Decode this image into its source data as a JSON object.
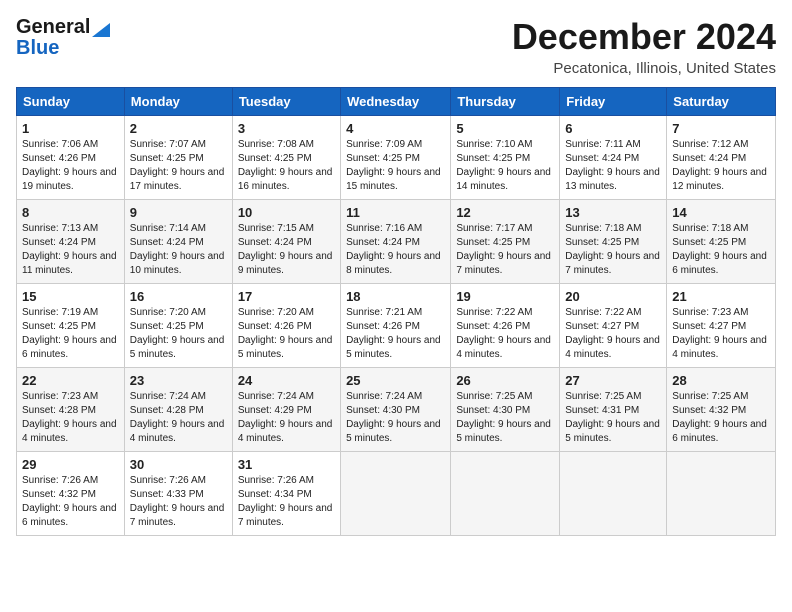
{
  "logo": {
    "line1": "General",
    "line2": "Blue"
  },
  "header": {
    "month": "December 2024",
    "location": "Pecatonica, Illinois, United States"
  },
  "weekdays": [
    "Sunday",
    "Monday",
    "Tuesday",
    "Wednesday",
    "Thursday",
    "Friday",
    "Saturday"
  ],
  "weeks": [
    [
      {
        "day": "1",
        "sunrise": "7:06 AM",
        "sunset": "4:26 PM",
        "daylight": "9 hours and 19 minutes."
      },
      {
        "day": "2",
        "sunrise": "7:07 AM",
        "sunset": "4:25 PM",
        "daylight": "9 hours and 17 minutes."
      },
      {
        "day": "3",
        "sunrise": "7:08 AM",
        "sunset": "4:25 PM",
        "daylight": "9 hours and 16 minutes."
      },
      {
        "day": "4",
        "sunrise": "7:09 AM",
        "sunset": "4:25 PM",
        "daylight": "9 hours and 15 minutes."
      },
      {
        "day": "5",
        "sunrise": "7:10 AM",
        "sunset": "4:25 PM",
        "daylight": "9 hours and 14 minutes."
      },
      {
        "day": "6",
        "sunrise": "7:11 AM",
        "sunset": "4:24 PM",
        "daylight": "9 hours and 13 minutes."
      },
      {
        "day": "7",
        "sunrise": "7:12 AM",
        "sunset": "4:24 PM",
        "daylight": "9 hours and 12 minutes."
      }
    ],
    [
      {
        "day": "8",
        "sunrise": "7:13 AM",
        "sunset": "4:24 PM",
        "daylight": "9 hours and 11 minutes."
      },
      {
        "day": "9",
        "sunrise": "7:14 AM",
        "sunset": "4:24 PM",
        "daylight": "9 hours and 10 minutes."
      },
      {
        "day": "10",
        "sunrise": "7:15 AM",
        "sunset": "4:24 PM",
        "daylight": "9 hours and 9 minutes."
      },
      {
        "day": "11",
        "sunrise": "7:16 AM",
        "sunset": "4:24 PM",
        "daylight": "9 hours and 8 minutes."
      },
      {
        "day": "12",
        "sunrise": "7:17 AM",
        "sunset": "4:25 PM",
        "daylight": "9 hours and 7 minutes."
      },
      {
        "day": "13",
        "sunrise": "7:18 AM",
        "sunset": "4:25 PM",
        "daylight": "9 hours and 7 minutes."
      },
      {
        "day": "14",
        "sunrise": "7:18 AM",
        "sunset": "4:25 PM",
        "daylight": "9 hours and 6 minutes."
      }
    ],
    [
      {
        "day": "15",
        "sunrise": "7:19 AM",
        "sunset": "4:25 PM",
        "daylight": "9 hours and 6 minutes."
      },
      {
        "day": "16",
        "sunrise": "7:20 AM",
        "sunset": "4:25 PM",
        "daylight": "9 hours and 5 minutes."
      },
      {
        "day": "17",
        "sunrise": "7:20 AM",
        "sunset": "4:26 PM",
        "daylight": "9 hours and 5 minutes."
      },
      {
        "day": "18",
        "sunrise": "7:21 AM",
        "sunset": "4:26 PM",
        "daylight": "9 hours and 5 minutes."
      },
      {
        "day": "19",
        "sunrise": "7:22 AM",
        "sunset": "4:26 PM",
        "daylight": "9 hours and 4 minutes."
      },
      {
        "day": "20",
        "sunrise": "7:22 AM",
        "sunset": "4:27 PM",
        "daylight": "9 hours and 4 minutes."
      },
      {
        "day": "21",
        "sunrise": "7:23 AM",
        "sunset": "4:27 PM",
        "daylight": "9 hours and 4 minutes."
      }
    ],
    [
      {
        "day": "22",
        "sunrise": "7:23 AM",
        "sunset": "4:28 PM",
        "daylight": "9 hours and 4 minutes."
      },
      {
        "day": "23",
        "sunrise": "7:24 AM",
        "sunset": "4:28 PM",
        "daylight": "9 hours and 4 minutes."
      },
      {
        "day": "24",
        "sunrise": "7:24 AM",
        "sunset": "4:29 PM",
        "daylight": "9 hours and 4 minutes."
      },
      {
        "day": "25",
        "sunrise": "7:24 AM",
        "sunset": "4:30 PM",
        "daylight": "9 hours and 5 minutes."
      },
      {
        "day": "26",
        "sunrise": "7:25 AM",
        "sunset": "4:30 PM",
        "daylight": "9 hours and 5 minutes."
      },
      {
        "day": "27",
        "sunrise": "7:25 AM",
        "sunset": "4:31 PM",
        "daylight": "9 hours and 5 minutes."
      },
      {
        "day": "28",
        "sunrise": "7:25 AM",
        "sunset": "4:32 PM",
        "daylight": "9 hours and 6 minutes."
      }
    ],
    [
      {
        "day": "29",
        "sunrise": "7:26 AM",
        "sunset": "4:32 PM",
        "daylight": "9 hours and 6 minutes."
      },
      {
        "day": "30",
        "sunrise": "7:26 AM",
        "sunset": "4:33 PM",
        "daylight": "9 hours and 7 minutes."
      },
      {
        "day": "31",
        "sunrise": "7:26 AM",
        "sunset": "4:34 PM",
        "daylight": "9 hours and 7 minutes."
      },
      null,
      null,
      null,
      null
    ]
  ]
}
